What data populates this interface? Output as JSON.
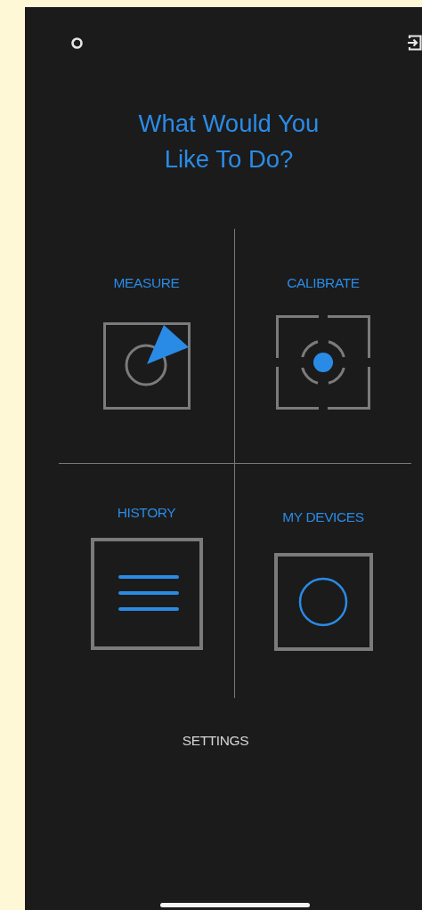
{
  "title": {
    "lines": [
      "What Would You",
      "Like To Do?"
    ]
  },
  "tiles": [
    {
      "label": "MEASURE",
      "kind": "measure"
    },
    {
      "label": "CALIBRATE",
      "kind": "calibrate"
    },
    {
      "label": "HISTORY",
      "kind": "history"
    },
    {
      "label": "MY DEVICES",
      "kind": "devices"
    }
  ],
  "settings": {
    "label": "SETTINGS"
  }
}
